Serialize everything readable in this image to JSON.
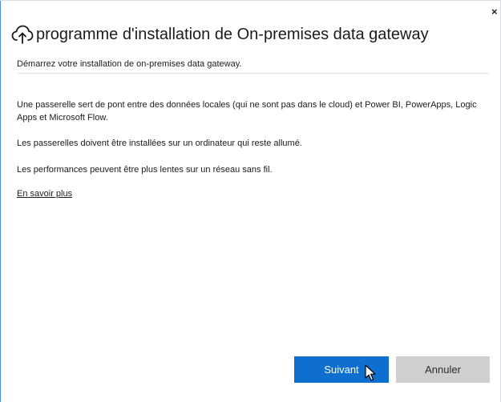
{
  "window": {
    "close_label": "×",
    "icon": "cloud-upload-icon",
    "title": "programme d'installation de On-premises data gateway",
    "subtitle": "Démarrez votre installation de on-premises data gateway."
  },
  "content": {
    "paragraph1": "Une passerelle sert de pont entre des données locales (qui ne sont pas dans le cloud) et Power BI, PowerApps, Logic Apps et Microsoft Flow.",
    "paragraph2": "Les passerelles doivent être installées sur un ordinateur qui reste allumé.",
    "paragraph3": "Les performances peuvent être plus lentes sur un réseau sans fil.",
    "learn_more": "En savoir plus"
  },
  "buttons": {
    "next": "Suivant",
    "cancel": "Annuler"
  },
  "colors": {
    "primary": "#0f6fce",
    "secondary": "#cfcfcf",
    "window_accent": "#4a90d9"
  }
}
